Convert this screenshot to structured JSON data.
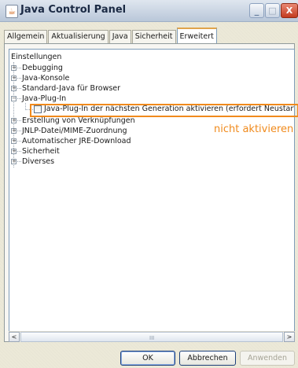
{
  "window": {
    "title": "Java Control Panel",
    "controls": {
      "minimize": "_",
      "maximize": "□",
      "close": "X"
    }
  },
  "tabs": [
    {
      "label": "Allgemein",
      "active": false
    },
    {
      "label": "Aktualisierung",
      "active": false
    },
    {
      "label": "Java",
      "active": false
    },
    {
      "label": "Sicherheit",
      "active": false
    },
    {
      "label": "Erweitert",
      "active": true
    }
  ],
  "tree": {
    "root": "Einstellungen",
    "items": [
      {
        "label": "Debugging",
        "expanded": false
      },
      {
        "label": "Java-Konsole",
        "expanded": false
      },
      {
        "label": "Standard-Java für Browser",
        "expanded": false
      },
      {
        "label": "Java-Plug-In",
        "expanded": true
      },
      {
        "label": "Erstellung von Verknüpfungen",
        "expanded": false
      },
      {
        "label": "JNLP-Datei/MIME-Zuordnung",
        "expanded": false
      },
      {
        "label": "Automatischer JRE-Download",
        "expanded": false
      },
      {
        "label": "Sicherheit",
        "expanded": false
      },
      {
        "label": "Diverses",
        "expanded": false
      }
    ],
    "plugin_option": {
      "label": "Java-Plug-In der nächsten Generation aktivieren (erfordert Neustart des Br",
      "checked": false
    }
  },
  "annotation": {
    "text": "nicht aktivieren",
    "color": "#f08a1c"
  },
  "scrollbar": {
    "left_arrow": "<",
    "right_arrow": ">",
    "grip": "III"
  },
  "buttons": {
    "ok": "OK",
    "cancel": "Abbrechen",
    "apply": "Anwenden"
  },
  "colors": {
    "accent_tab": "#e0a44b",
    "highlight": "#f08a1c",
    "close_button": "#c33b1f"
  },
  "icons": [
    "java-cup-icon",
    "minimize-icon",
    "maximize-icon",
    "close-icon",
    "expand-plus-icon",
    "collapse-minus-icon"
  ]
}
